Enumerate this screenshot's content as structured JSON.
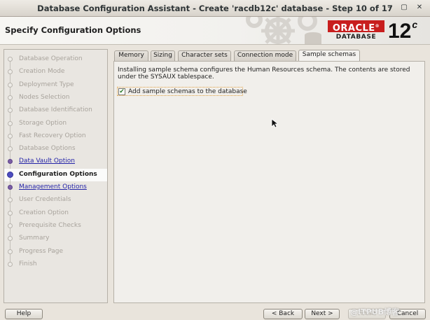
{
  "window": {
    "title": "Database Configuration Assistant - Create 'racdb12c' database - Step 10 of 17",
    "controls": [
      "minimize-icon",
      "restore-icon",
      "close-icon"
    ]
  },
  "header": {
    "page_title": "Specify Configuration Options",
    "brand": "ORACLE",
    "brand_reg": "®",
    "product": "DATABASE",
    "version": "12",
    "version_sup": "c",
    "brand_color": "#c81e1e"
  },
  "steps": [
    {
      "label": "Database Operation",
      "state": "done"
    },
    {
      "label": "Creation Mode",
      "state": "done"
    },
    {
      "label": "Deployment Type",
      "state": "done"
    },
    {
      "label": "Nodes Selection",
      "state": "done"
    },
    {
      "label": "Database Identification",
      "state": "done"
    },
    {
      "label": "Storage Option",
      "state": "done"
    },
    {
      "label": "Fast Recovery Option",
      "state": "done"
    },
    {
      "label": "Database Options",
      "state": "done"
    },
    {
      "label": "Data Vault Option",
      "state": "link"
    },
    {
      "label": "Configuration Options",
      "state": "current"
    },
    {
      "label": "Management Options",
      "state": "link"
    },
    {
      "label": "User Credentials",
      "state": "pending"
    },
    {
      "label": "Creation Option",
      "state": "pending"
    },
    {
      "label": "Prerequisite Checks",
      "state": "pending"
    },
    {
      "label": "Summary",
      "state": "pending"
    },
    {
      "label": "Progress Page",
      "state": "pending"
    },
    {
      "label": "Finish",
      "state": "pending"
    }
  ],
  "tabs": [
    {
      "label": "Memory"
    },
    {
      "label": "Sizing"
    },
    {
      "label": "Character sets"
    },
    {
      "label": "Connection mode"
    },
    {
      "label": "Sample schemas",
      "active": true
    }
  ],
  "panel": {
    "description": "Installing sample schema configures the Human Resources schema. The contents are stored under the SYSAUX tablespace.",
    "checkbox_label": "Add sample schemas to the database",
    "checkbox_checked": true
  },
  "buttons": {
    "help": "Help",
    "back": "< Back",
    "next": "Next >",
    "finish": "Finish",
    "cancel": "Cancel"
  },
  "watermark": "@ITPUB博客"
}
